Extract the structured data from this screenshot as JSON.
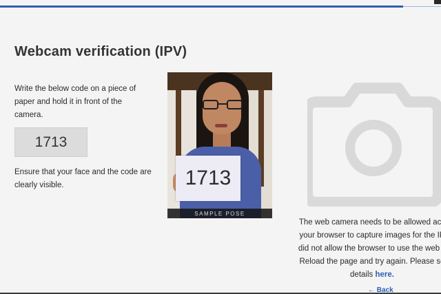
{
  "page": {
    "title": "Webcam verification (IPV)",
    "instruction": "Write the below code on a piece of paper and hold it in front of the camera.",
    "code": "1713",
    "ensure_text": "Ensure that your face and the code are clearly visible."
  },
  "sample": {
    "code_on_paper": "1713",
    "caption": "SAMPLE POSE"
  },
  "camera_message": {
    "line1": "The web camera needs to be allowed acc",
    "line2": "your browser to capture images for the IP",
    "line3": "did not allow the browser to use the web c",
    "line4": "Reload the page and try again. Please se",
    "details_prefix": "details ",
    "link_label": "here.",
    "back_link": "← Back"
  },
  "icons": {
    "camera": "camera-icon"
  },
  "colors": {
    "accent": "#2d5fb1",
    "camera_icon": "#d9d9d9",
    "code_box": "#dcdcdc"
  }
}
